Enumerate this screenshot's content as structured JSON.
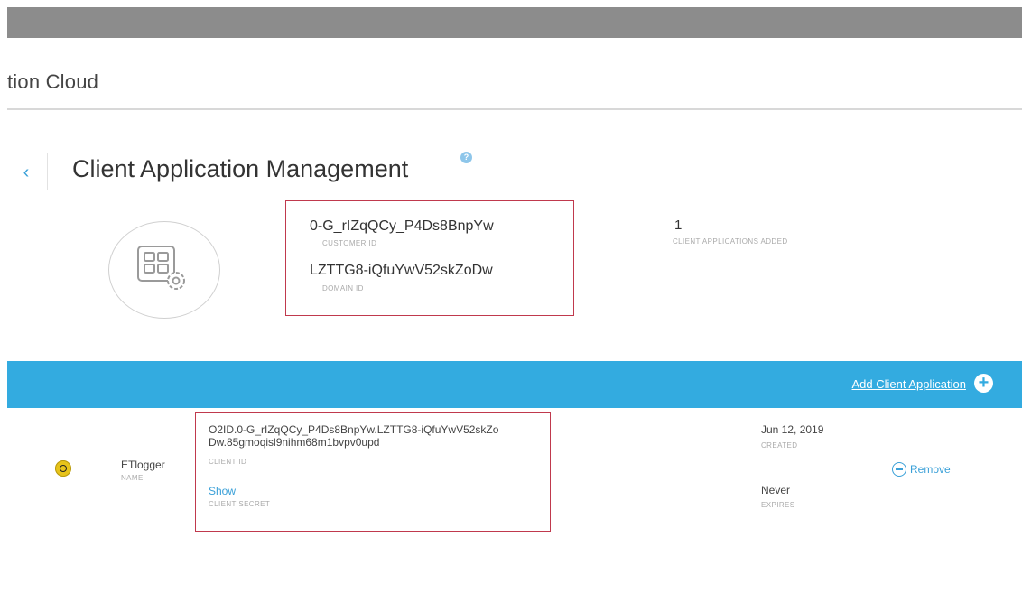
{
  "app": {
    "title": "tion Cloud"
  },
  "page": {
    "title": "Client Application Management",
    "back_icon": "‹",
    "help_icon": "?"
  },
  "summary": {
    "customer_id_value": "0-G_rIZqQCy_P4Ds8BnpYw",
    "customer_id_label": "CUSTOMER ID",
    "domain_id_value": "LZTTG8-iQfuYwV52skZoDw",
    "domain_id_label": "DOMAIN ID",
    "apps_count": "1",
    "apps_count_label": "CLIENT APPLICATIONS ADDED"
  },
  "toolbar": {
    "add_label": "Add Client Application",
    "add_icon": "+"
  },
  "clients": [
    {
      "name": "ETlogger",
      "name_label": "NAME",
      "client_id": "O2ID.0-G_rIZqQCy_P4Ds8BnpYw.LZTTG8-iQfuYwV52skZoDw.85gmoqisl9nihm68m1bvpv0upd",
      "client_id_label": "CLIENT ID",
      "secret_action": "Show",
      "secret_label": "CLIENT SECRET",
      "created": "Jun 12, 2019",
      "created_label": "CREATED",
      "expires": "Never",
      "expires_label": "EXPIRES",
      "remove_label": "Remove"
    }
  ],
  "colors": {
    "accent": "#33abe0",
    "highlight_border": "#c0394d",
    "link": "#3aa0d8"
  }
}
